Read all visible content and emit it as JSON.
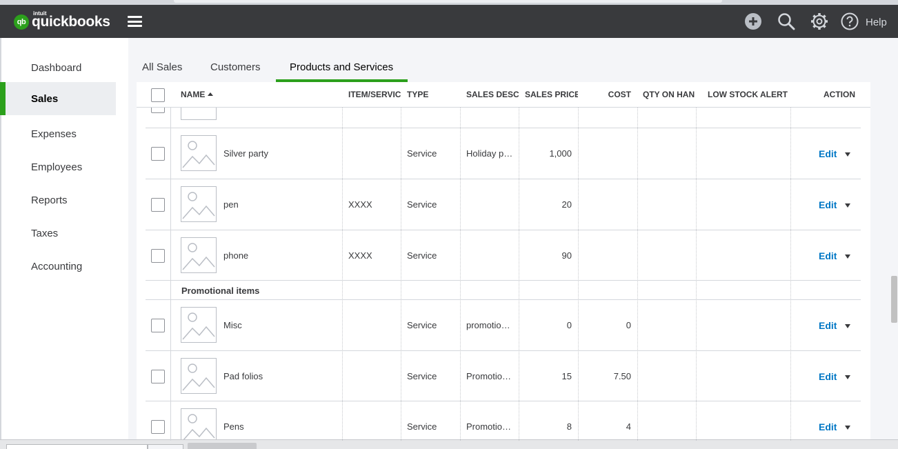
{
  "header": {
    "brand_small": "intuit",
    "brand": "quickbooks",
    "brand_mark": "qb",
    "help_label": "Help",
    "icons": [
      "plus-circle-icon",
      "search-icon",
      "gear-icon",
      "help-icon"
    ]
  },
  "sidebar": {
    "items": [
      {
        "label": "Dashboard",
        "active": false
      },
      {
        "label": "Sales",
        "active": true
      },
      {
        "label": "Expenses",
        "active": false
      },
      {
        "label": "Employees",
        "active": false
      },
      {
        "label": "Reports",
        "active": false
      },
      {
        "label": "Taxes",
        "active": false
      },
      {
        "label": "Accounting",
        "active": false
      }
    ]
  },
  "tabs": [
    {
      "label": "All Sales",
      "active": false
    },
    {
      "label": "Customers",
      "active": false
    },
    {
      "label": "Products and Services",
      "active": true
    }
  ],
  "table": {
    "columns": {
      "name": "NAME",
      "item_service": "ITEM/SERVIC",
      "type": "TYPE",
      "sales_desc": "SALES DESCR",
      "sales_price": "SALES PRICE",
      "cost": "COST",
      "qty_on_hand": "QTY ON HAN",
      "low_stock": "LOW STOCK ALERT",
      "action": "ACTION"
    },
    "rows": [
      {
        "name": "Silver party",
        "sku": "",
        "type": "Service",
        "desc": "Holiday p…",
        "price": "1,000",
        "cost": "",
        "action": "Edit"
      },
      {
        "name": "pen",
        "sku": "XXXX",
        "type": "Service",
        "desc": "",
        "price": "20",
        "cost": "",
        "action": "Edit"
      },
      {
        "name": "phone",
        "sku": "XXXX",
        "type": "Service",
        "desc": "",
        "price": "90",
        "cost": "",
        "action": "Edit"
      }
    ],
    "group_label": "Promotional items",
    "group_rows": [
      {
        "name": "Misc",
        "sku": "",
        "type": "Service",
        "desc": "promotio…",
        "price": "0",
        "cost": "0",
        "action": "Edit"
      },
      {
        "name": "Pad folios",
        "sku": "",
        "type": "Service",
        "desc": "Promotio…",
        "price": "15",
        "cost": "7.50",
        "action": "Edit"
      },
      {
        "name": "Pens",
        "sku": "",
        "type": "Service",
        "desc": "Promotio…",
        "price": "8",
        "cost": "4",
        "action": "Edit"
      }
    ]
  },
  "colors": {
    "brand_green": "#2ca01c",
    "header_bg": "#393a3d",
    "link_blue": "#0077c5"
  }
}
